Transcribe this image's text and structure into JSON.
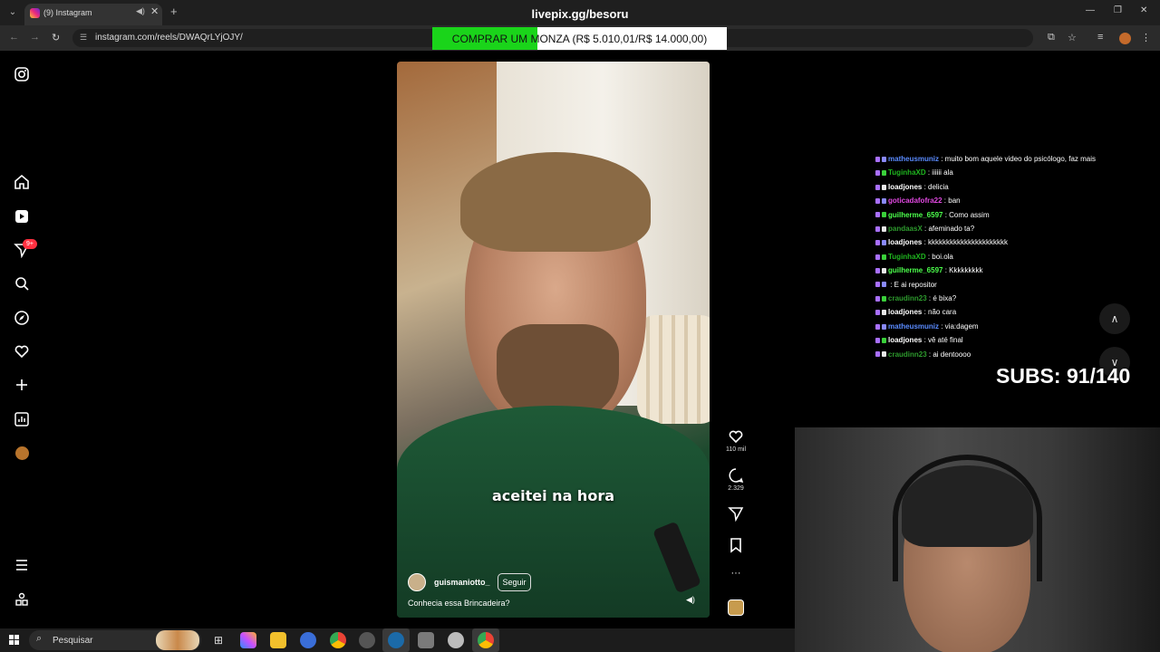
{
  "browser": {
    "tab_title": "(9) Instagram",
    "url": "instagram.com/reels/DWAQrLYjOJY/",
    "stream_title": "livepix.gg/besoru"
  },
  "donation": {
    "text": "COMPRAR UM MONZA (R$ 5.010,01/R$ 14.000,00)",
    "progress_fraction": 0.358,
    "fill_color": "#1ad41a"
  },
  "sidebar": {
    "badge": "9+",
    "icons": [
      "instagram-icon",
      "home-icon",
      "reels-icon",
      "messages-icon",
      "search-icon",
      "explore-icon",
      "heart-icon",
      "create-icon",
      "dashboard-icon",
      "profile-avatar",
      "menu-icon",
      "apps-icon"
    ]
  },
  "reel": {
    "caption": "aceitei na hora",
    "author": "guismaniotto_",
    "follow_label": "Seguir",
    "description": "Conhecia essa Brincadeira?",
    "likes": "110 mil",
    "comments": "2.329",
    "more": "···"
  },
  "chat": {
    "lines": [
      {
        "user": "matheusmuniz",
        "color": "#5a8bff",
        "text": ": muito bom aquele video do psicólogo, faz mais"
      },
      {
        "user": "TuginhaXD",
        "color": "#1fb51f",
        "text": ": iiiiii ala"
      },
      {
        "user": "loadjones",
        "color": "#ffffff",
        "text": ": delicia"
      },
      {
        "user": "goticadafofra22",
        "color": "#e048e0",
        "text": ": ban"
      },
      {
        "user": "guilherme_6597",
        "color": "#4cff4c",
        "text": ": Como assim"
      },
      {
        "user": "pandaasX",
        "color": "#2d9a2d",
        "text": ": afeminado ta?"
      },
      {
        "user": "loadjones",
        "color": "#ffffff",
        "text": ": kkkkkkkkkkkkkkkkkkkkkk"
      },
      {
        "user": "TuginhaXD",
        "color": "#1fb51f",
        "text": ": boi.ola"
      },
      {
        "user": "guilherme_6597",
        "color": "#4cff4c",
        "text": ": Kkkkkkkkk"
      },
      {
        "user": "",
        "color": "#2d2dff",
        "text": ": E ai repositor"
      },
      {
        "user": "craudinn23",
        "color": "#2d9a2d",
        "text": ": é bixa?"
      },
      {
        "user": "loadjones",
        "color": "#ffffff",
        "text": ": não cara"
      },
      {
        "user": "matheusmuniz",
        "color": "#5a8bff",
        "text": ": via:dagem"
      },
      {
        "user": "loadjones",
        "color": "#ffffff",
        "text": ": vê até final"
      },
      {
        "user": "craudinn23",
        "color": "#2d9a2d",
        "text": ": ai dentoooo"
      }
    ]
  },
  "subs": {
    "text": "SUBS: 91/140"
  },
  "taskbar": {
    "search_label": "Pesquisar"
  }
}
